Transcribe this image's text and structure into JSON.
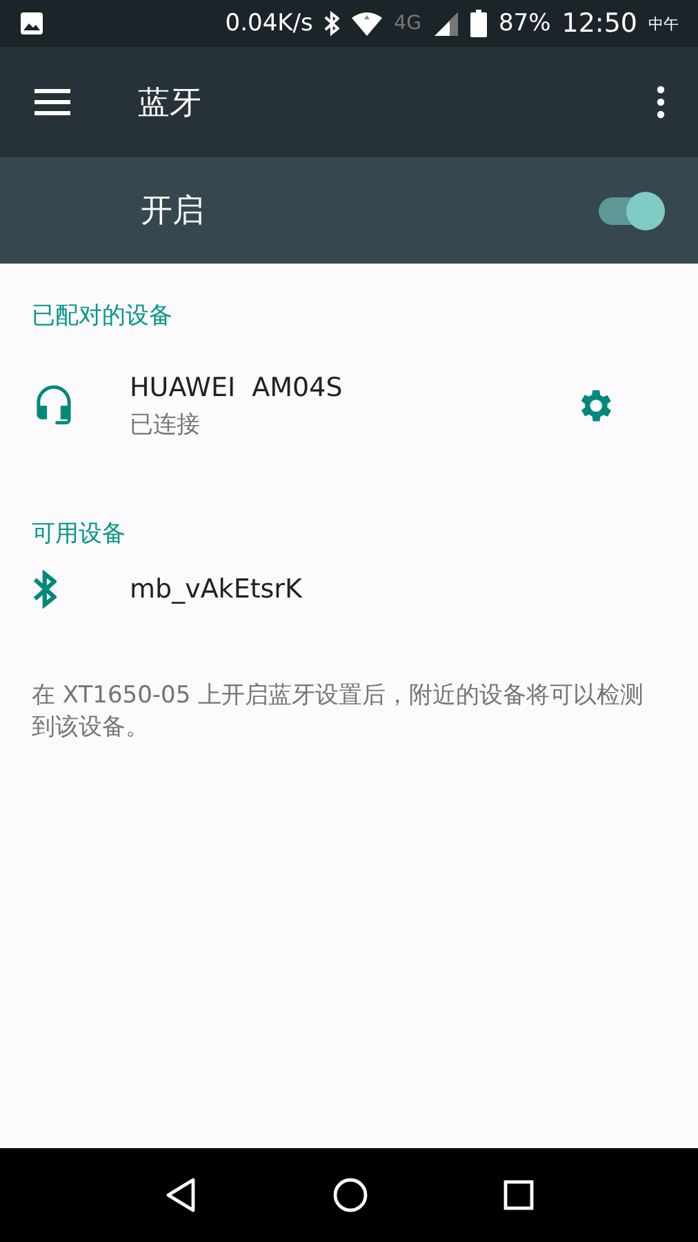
{
  "status_bar": {
    "speed": "0.04K/s",
    "network": "4G",
    "battery": "87%",
    "time": "12:50",
    "period": "中午"
  },
  "app_bar": {
    "title": "蓝牙"
  },
  "master_switch": {
    "label": "开启",
    "on": true
  },
  "sections": [
    {
      "title": "已配对的设备",
      "devices": [
        {
          "kind": "headset",
          "name": "HUAWEI  AM04S",
          "status": "已连接",
          "has_settings": true
        }
      ]
    },
    {
      "title": "可用设备",
      "devices": [
        {
          "kind": "bluetooth",
          "name": "mb_vAkEtsrK"
        }
      ]
    }
  ],
  "footer_note": "在 XT1650-05 上开启蓝牙设置后，附近的设备将可以检测到该设备。"
}
